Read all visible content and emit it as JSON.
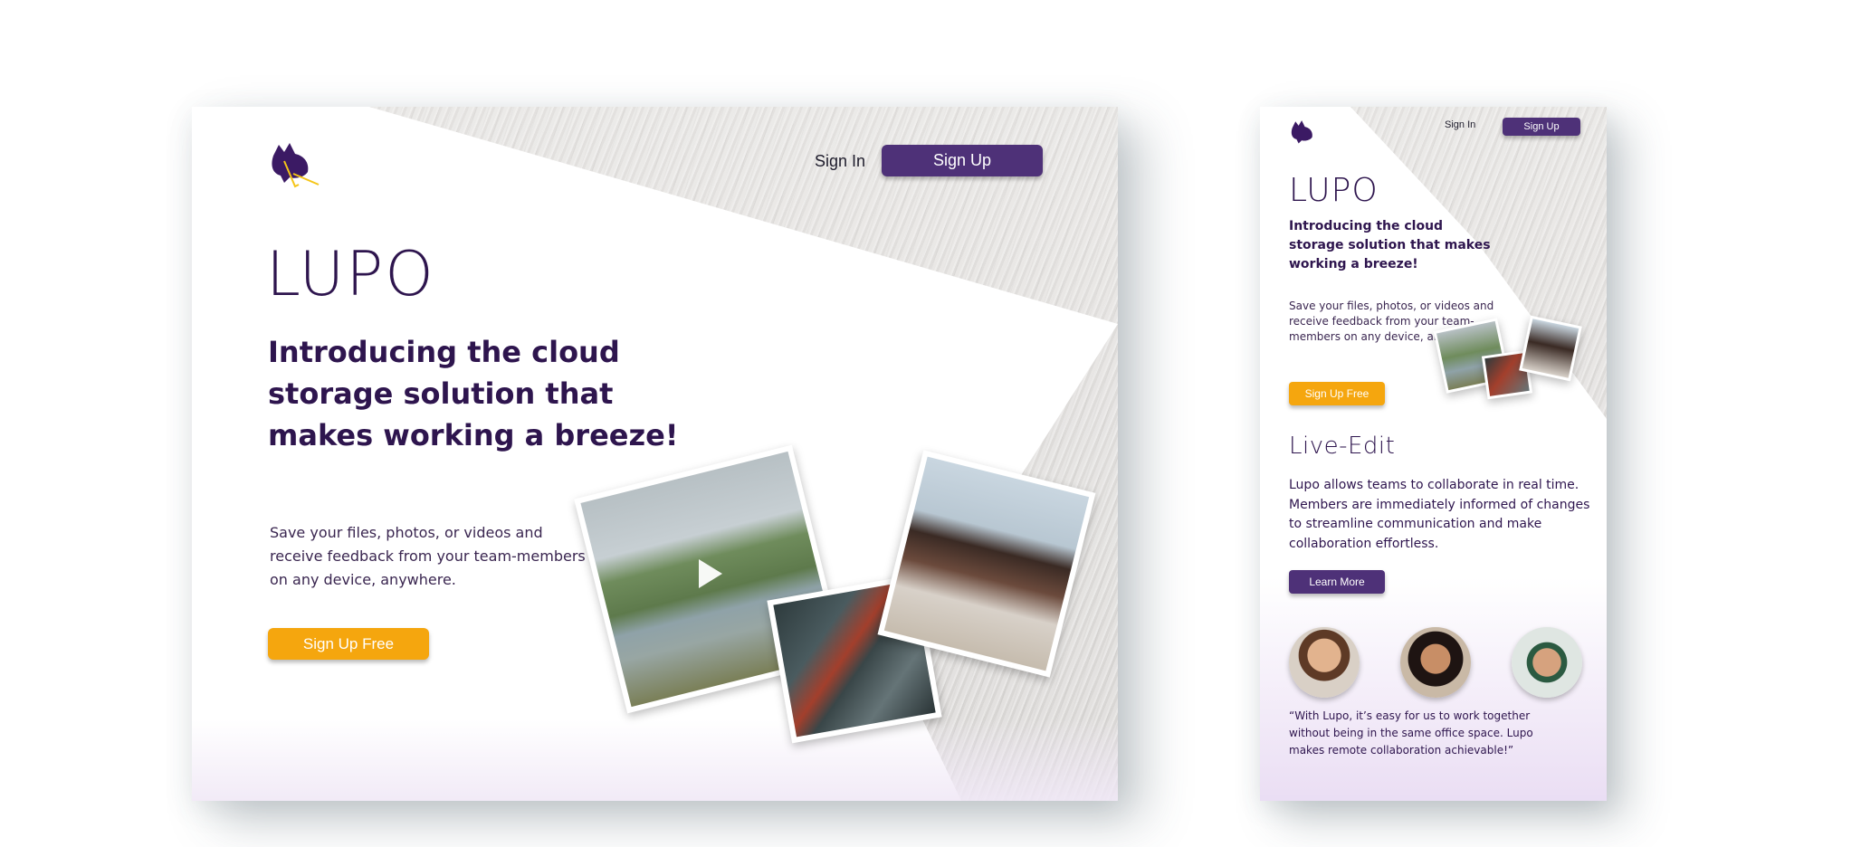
{
  "colors": {
    "brand_purple": "#2e154e",
    "button_purple": "#4e3178",
    "accent_orange": "#f5a60e",
    "lavender_fade": "#e9dcf3"
  },
  "desktop": {
    "logo_icon": "wolf-head-icon",
    "nav": {
      "signin": "Sign In",
      "signup": "Sign Up"
    },
    "brand": "LUPO",
    "headline": "Introducing the cloud storage solution that makes working a breeze!",
    "body": "Save your files, photos, or videos and receive feedback from your team-members on any device, anywhere.",
    "cta": "Sign Up Free",
    "photos": [
      "person-jumping-photo",
      "city-aerial-photo",
      "friends-laughing-photo"
    ],
    "play_icon": "play-icon"
  },
  "mobile": {
    "logo_icon": "wolf-head-icon",
    "nav": {
      "signin": "Sign In",
      "signup": "Sign Up"
    },
    "brand": "LUPO",
    "headline": "Introducing the cloud storage solution that makes working a breeze!",
    "body": "Save your files, photos, or videos and receive feedback from your team-members on any device, anywhere.",
    "cta": "Sign Up Free",
    "feature_title": "Live-Edit",
    "feature_body": "Lupo allows teams to collaborate in real time. Members are immediately informed of changes to streamline communication and make collaboration effortless.",
    "feature_button": "Learn More",
    "testimonial": "“With Lupo, it’s easy for us to work together without being in the same office space. Lupo makes remote collaboration achievable!”"
  }
}
